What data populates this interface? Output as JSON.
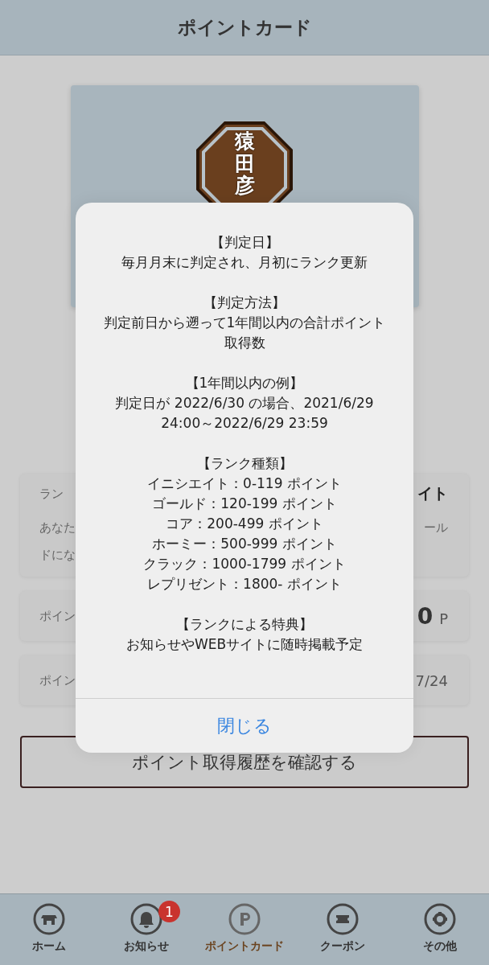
{
  "header": {
    "title": "ポイントカード"
  },
  "card": {
    "emblem": "猿田彦"
  },
  "rows": [
    {
      "left": "ラン",
      "right": "イト",
      "desc": [
        {
          "left": "あなた",
          "right": "ール"
        },
        {
          "left": "ドにな"
        }
      ]
    },
    {
      "left": "ポイン",
      "value": "0",
      "unit": "P"
    },
    {
      "left": "ポイン",
      "right": "7/24"
    }
  ],
  "history_button": "ポイント取得履歴を確認する",
  "modal": {
    "sections": [
      {
        "heading": "【判定日】",
        "lines": [
          "毎月月末に判定され、月初にランク更新"
        ]
      },
      {
        "heading": "【判定方法】",
        "lines": [
          "判定前日から遡って1年間以内の合計ポイント取得数"
        ]
      },
      {
        "heading": "【1年間以内の例】",
        "lines": [
          "判定日が 2022/6/30 の場合、2021/6/29 24:00～2022/6/29 23:59"
        ]
      },
      {
        "heading": "【ランク種類】",
        "lines": [
          "イニシエイト：0-119 ポイント",
          "ゴールド：120-199 ポイント",
          "コア：200-499 ポイント",
          "ホーミー：500-999 ポイント",
          "クラック：1000-1799 ポイント",
          "レプリゼント：1800- ポイント"
        ]
      },
      {
        "heading": "【ランクによる特典】",
        "lines": [
          "お知らせやWEBサイトに随時掲載予定"
        ]
      }
    ],
    "close": "閉じる"
  },
  "tabs": [
    {
      "label": "ホーム",
      "selected": false
    },
    {
      "label": "お知らせ",
      "selected": false,
      "badge": "1"
    },
    {
      "label": "ポイントカード",
      "selected": true
    },
    {
      "label": "クーポン",
      "selected": false
    },
    {
      "label": "その他",
      "selected": false
    }
  ]
}
